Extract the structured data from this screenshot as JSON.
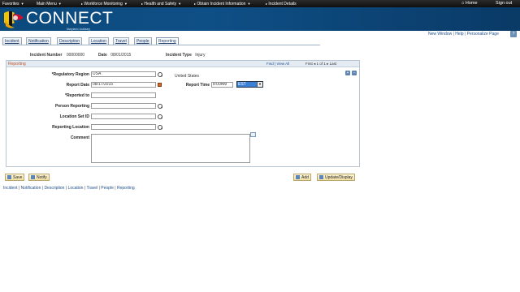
{
  "nav": {
    "items": [
      {
        "label": "Favorites"
      },
      {
        "label": "Main Menu"
      },
      {
        "label": "Workforce Monitoring"
      },
      {
        "label": "Health and Safety"
      },
      {
        "label": "Obtain Incident Information"
      },
      {
        "label": "Incident Details"
      }
    ],
    "home": "Home",
    "signout": "Sign out"
  },
  "brand": {
    "name": "CONNECT",
    "sub": "Maryland Judiciary"
  },
  "top_links": {
    "new_window": "New Window",
    "help": "Help",
    "personalize": "Personalize Page"
  },
  "tabs": [
    "Incident",
    "Notification",
    "Description",
    "Location",
    "Travel",
    "People",
    "Reporting"
  ],
  "header": {
    "incident_number_label": "Incident Number",
    "incident_number": "00000000",
    "date_label": "Date",
    "date": "08/01/2015",
    "incident_type_label": "Incident Type",
    "incident_type": "Injury"
  },
  "reporting": {
    "title": "Reporting",
    "find": "Find",
    "view_all": "View All",
    "first": "First",
    "pager": "1 of 1",
    "last": "Last",
    "fields": {
      "region_label": "*Regulatory Region",
      "region_value": "USA",
      "region_desc": "United States",
      "report_date_label": "Report Date",
      "report_date_value": "08/17/2015",
      "report_time_label": "Report Time",
      "report_time_value": "8:00AM",
      "timezone": "EST",
      "reported_to_label": "*Reported to",
      "person_reporting_label": "Person Reporting",
      "location_set_id_label": "Location Set ID",
      "reporting_location_label": "Reporting Location",
      "comment_label": "Comment"
    }
  },
  "buttons": {
    "save": "Save",
    "notify": "Notify",
    "add": "Add",
    "update_display": "Update/Display"
  },
  "bottom_links": [
    "Incident",
    "Notification",
    "Description",
    "Location",
    "Travel",
    "People",
    "Reporting"
  ]
}
